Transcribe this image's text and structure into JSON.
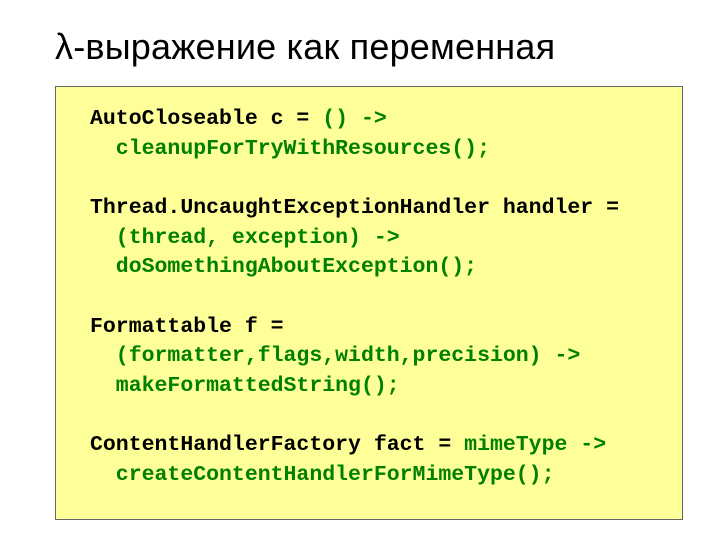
{
  "slide": {
    "title": "λ-выражение как переменная",
    "code": {
      "l1a": "AutoCloseable c = ",
      "l1b": "() ->",
      "l2": "  cleanupForTryWithResources();",
      "l3": "Thread.UncaughtExceptionHandler handler =",
      "l4": "  (thread, exception) ->",
      "l5": "  doSomethingAboutException();",
      "l6": "Formattable f =",
      "l7": "  (formatter,flags,width,precision) ->",
      "l8": "  makeFormattedString();",
      "l9a": "ContentHandlerFactory fact = ",
      "l9b": "mimeType ->",
      "l10": "  createContentHandlerForMimeType();"
    }
  }
}
